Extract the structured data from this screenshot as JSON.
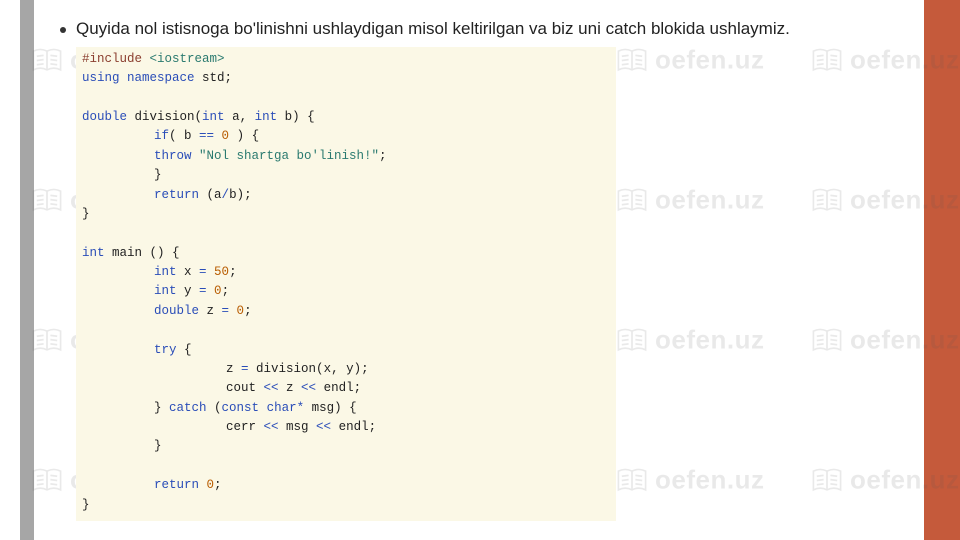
{
  "watermark": {
    "text": "oefen.uz"
  },
  "slide": {
    "heading": "Quyida nol istisnoga bo'linishni ushlaydigan misol keltirilgan va biz uni catch blokida ushlaymiz."
  },
  "code": {
    "l1_include": "#include ",
    "l1_header": "<iostream>",
    "l2_using": "using",
    "l2_namespace": " namespace",
    "l2_std": " std",
    "l2_semi": ";",
    "l4_double": "double",
    "l4_fn": " division",
    "l4_open": "(",
    "l4_int1": "int",
    "l4_a": " a",
    "l4_comma": ", ",
    "l4_int2": "int",
    "l4_b": " b",
    "l4_close": ") {",
    "l5_if": "if",
    "l5_cond": "( b ",
    "l5_eq": "==",
    "l5_zero": " 0",
    "l5_rest": " ) {",
    "l6_throw": "throw",
    "l6_str": " \"Nol shartga bo'linish!\"",
    "l6_semi": ";",
    "l7_brace": "}",
    "l8_return": "return",
    "l8_open": " (",
    "l8_a": "a",
    "l8_slash": "/",
    "l8_b": "b",
    "l8_close": ");",
    "l9_brace": "}",
    "l11_int": "int",
    "l11_main": " main () {",
    "l12_int": "int",
    "l12_x": " x ",
    "l12_eq": "=",
    "l12_val": " 50",
    "l12_semi": ";",
    "l13_int": "int",
    "l13_y": " y ",
    "l13_eq": "=",
    "l13_val": " 0",
    "l13_semi": ";",
    "l14_double": "double",
    "l14_z": " z ",
    "l14_eq": "=",
    "l14_val": " 0",
    "l14_semi": ";",
    "l16_try": "try",
    "l16_brace": " {",
    "l17_z": "z ",
    "l17_eq": "=",
    "l17_call": " division",
    "l17_open": "(",
    "l17_x": "x",
    "l17_comma": ", ",
    "l17_y": "y",
    "l17_close": ");",
    "l18_cout": "cout ",
    "l18_op1": "<<",
    "l18_z": " z ",
    "l18_op2": "<<",
    "l18_endl": " endl",
    "l18_semi": ";",
    "l19_closebrace": "} ",
    "l19_catch": "catch",
    "l19_open": " (",
    "l19_const": "const",
    "l19_char": " char",
    "l19_star": "*",
    "l19_msg": " msg",
    "l19_close": ") {",
    "l20_cerr": "cerr ",
    "l20_op1": "<<",
    "l20_msg": " msg ",
    "l20_op2": "<<",
    "l20_endl": " endl",
    "l20_semi": ";",
    "l21_brace": "}",
    "l23_return": "return",
    "l23_val": " 0",
    "l23_semi": ";",
    "l24_brace": "}"
  }
}
